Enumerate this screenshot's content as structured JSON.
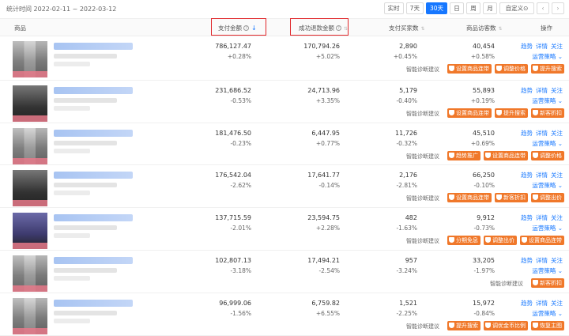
{
  "header": {
    "stat_time": "统计时间 2022-02-11 ~ 2022-03-12",
    "ranges": [
      "实时",
      "7天",
      "30天",
      "日",
      "周",
      "月",
      "自定义"
    ],
    "active_range": "30天",
    "custom_suffix": "⊙"
  },
  "columns": {
    "product": "商品",
    "pay_amount": "支付金额",
    "refund_amount": "成功退款金额",
    "buyers": "支付买家数",
    "visitors": "商品访客数",
    "ops": "操作"
  },
  "op_labels": {
    "trend": "趋势",
    "detail": "详情",
    "follow": "关注",
    "strategy": "运营策略"
  },
  "diag_label": "智能诊断建议",
  "rows": [
    {
      "pay": "786,127.47",
      "pay_ch": "+0.28%",
      "refund": "170,794.26",
      "refund_ch": "+5.02%",
      "buyers": "2,890",
      "buyers_ch": "+0.45%",
      "visitors": "40,454",
      "visitors_ch": "+0.58%",
      "tags": [
        "设置商品连带",
        "调整价格",
        "提升搜索"
      ],
      "diag": true
    },
    {
      "pay": "231,686.52",
      "pay_ch": "-0.53%",
      "refund": "24,713.96",
      "refund_ch": "+3.35%",
      "buyers": "5,179",
      "buyers_ch": "-0.40%",
      "visitors": "55,893",
      "visitors_ch": "+0.19%",
      "tags": [
        "设置商品连带",
        "提升搜索",
        "新客折扣"
      ],
      "diag": true
    },
    {
      "pay": "181,476.50",
      "pay_ch": "-0.23%",
      "refund": "6,447.95",
      "refund_ch": "+0.77%",
      "buyers": "11,726",
      "buyers_ch": "-0.32%",
      "visitors": "45,510",
      "visitors_ch": "+0.69%",
      "tags": [
        "趋势推广",
        "设置商品连带",
        "调整价格"
      ],
      "diag": true
    },
    {
      "pay": "176,542.04",
      "pay_ch": "-2.62%",
      "refund": "17,641.77",
      "refund_ch": "-0.14%",
      "buyers": "2,176",
      "buyers_ch": "-2.81%",
      "visitors": "66,250",
      "visitors_ch": "-0.10%",
      "tags": [
        "设置商品连带",
        "新客折扣",
        "调整出价"
      ],
      "diag": true
    },
    {
      "pay": "137,715.59",
      "pay_ch": "-2.01%",
      "refund": "23,594.75",
      "refund_ch": "+2.28%",
      "buyers": "482",
      "buyers_ch": "-1.63%",
      "visitors": "9,912",
      "visitors_ch": "-0.73%",
      "tags": [
        "分期免息",
        "调整出价",
        "设置商品连带"
      ],
      "diag": true
    },
    {
      "pay": "102,807.13",
      "pay_ch": "-3.18%",
      "refund": "17,494.21",
      "refund_ch": "-2.54%",
      "buyers": "957",
      "buyers_ch": "-3.24%",
      "visitors": "33,205",
      "visitors_ch": "-1.97%",
      "tags": [
        "新客折扣"
      ],
      "diag": true
    },
    {
      "pay": "96,999.06",
      "pay_ch": "-1.56%",
      "refund": "6,759.82",
      "refund_ch": "+6.55%",
      "buyers": "1,521",
      "buyers_ch": "-2.25%",
      "visitors": "15,972",
      "visitors_ch": "-0.84%",
      "tags": [
        "提升搜索",
        "调优金币比例",
        "恢复主图"
      ],
      "diag": true
    }
  ],
  "icons": [
    "help-icon",
    "sort-icon",
    "chevron-left-icon",
    "chevron-right-icon",
    "tag-icon"
  ],
  "colors": {
    "accent": "#1677ff",
    "tag": "#f0782a",
    "highlight": "#e0262a"
  }
}
